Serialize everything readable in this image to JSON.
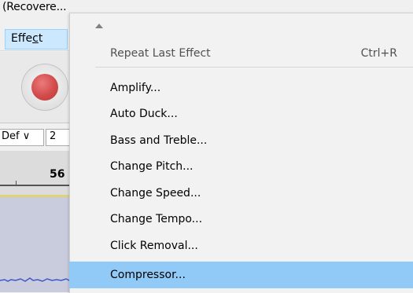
{
  "window": {
    "title": "(Recovere..."
  },
  "menubar": {
    "effect_label_pre": "Effe",
    "effect_label_key": "c",
    "effect_label_post": "t"
  },
  "device_toolbar": {
    "host_value": "Def",
    "host_arrow": "∨",
    "channels_value": "2"
  },
  "ruler": {
    "label": "56"
  },
  "colors": {
    "highlight": "#91c9f7",
    "menu_bg": "#f2f2f2",
    "record": "#d24b4b"
  },
  "effect_menu": {
    "scroll_indicator": "chevron-up-icon",
    "items": [
      {
        "label": "Repeat Last Effect",
        "shortcut": "Ctrl+R",
        "state": "disabled"
      },
      {
        "label": "Amplify...",
        "shortcut": "",
        "state": "normal"
      },
      {
        "label": "Auto Duck...",
        "shortcut": "",
        "state": "normal"
      },
      {
        "label": "Bass and Treble...",
        "shortcut": "",
        "state": "normal"
      },
      {
        "label": "Change Pitch...",
        "shortcut": "",
        "state": "normal"
      },
      {
        "label": "Change Speed...",
        "shortcut": "",
        "state": "normal"
      },
      {
        "label": "Change Tempo...",
        "shortcut": "",
        "state": "normal"
      },
      {
        "label": "Click Removal...",
        "shortcut": "",
        "state": "normal"
      },
      {
        "label": "Compressor...",
        "shortcut": "",
        "state": "highlighted"
      }
    ]
  }
}
